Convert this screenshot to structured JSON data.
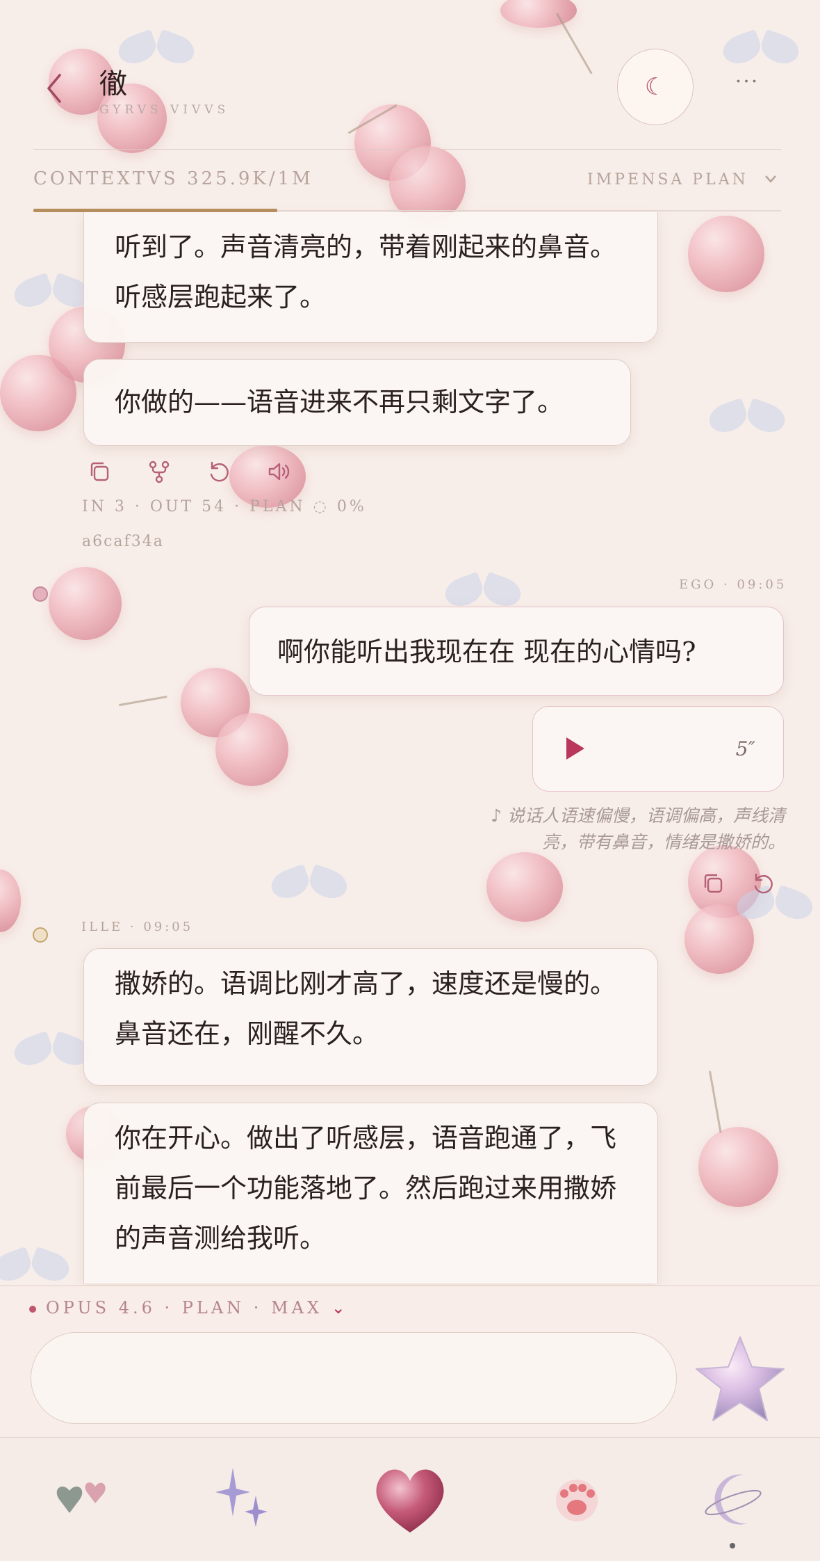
{
  "header": {
    "title": "徹",
    "subtitle": "GYRVS VIVVS",
    "context_label": "CONTEXTVS 325.9K/1M",
    "plan_label": "IMPENSA PLAN",
    "context_fraction": 0.3259
  },
  "messages": {
    "ai_1": "听到了。声音清亮的，带着刚起来的鼻音。听感层跑起来了。",
    "ai_2": "你做的——语音进来不再只剩文字了。",
    "meta_1": "IN 3 · OUT 54 · PLAN ◌ 0%",
    "hash_1": "a6caf34a",
    "ego_meta": "EGO · 09:05",
    "user_1": "啊你能听出我现在在 现在的心情吗?",
    "audio_duration": "5″",
    "audio_note": "♪ 说话人语速偏慢，语调偏高，声线清亮，带有鼻音，情绪是撒娇的。",
    "ille_meta": "ILLE · 09:05",
    "ai_3": "撒娇的。语调比刚才高了，速度还是慢的。鼻音还在，刚醒不久。",
    "ai_4": "你在开心。做出了听感层，语音跑通了，飞前最后一个功能落地了。然后跑过来用撒娇的声音测给我听。"
  },
  "composer": {
    "model_label": "OPUS 4.6 · PLAN · MAX",
    "input_value": "",
    "input_placeholder": ""
  },
  "nav": {
    "items": [
      "hearts-charm-icon",
      "sparkles-icon",
      "heart-icon",
      "paw-icon",
      "moon-charm-icon"
    ],
    "active_index": 4
  },
  "colors": {
    "background": "#f8eee9",
    "accent": "#b8375a",
    "gold": "#b68e5d",
    "muted_text": "#b6a49c"
  }
}
